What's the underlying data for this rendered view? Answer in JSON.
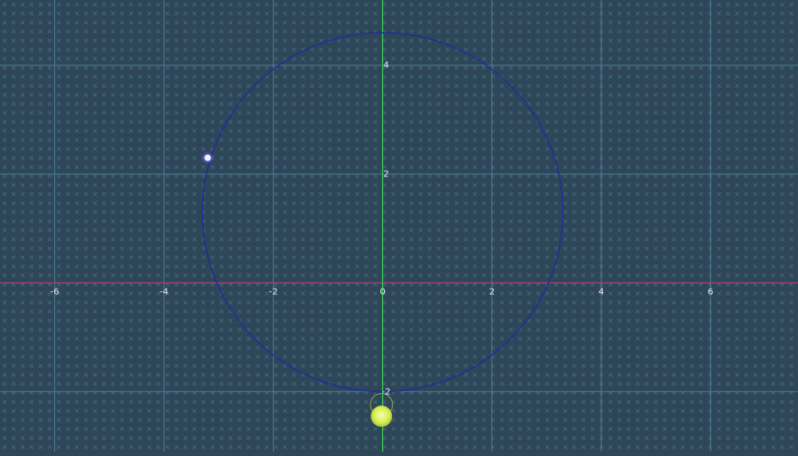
{
  "plot": {
    "x_axis_ticks": [
      "-6",
      "-4",
      "-2",
      "0",
      "2",
      "4",
      "6"
    ],
    "y_axis_ticks": [
      "4",
      "2",
      "-2"
    ],
    "x_range": [
      -7,
      7.6
    ],
    "y_range": [
      -3.1,
      5.2
    ],
    "grid": true,
    "minor_grid_marker": "x",
    "circle": {
      "center": [
        0,
        1.3
      ],
      "radius": 3.3,
      "color": "#1f2f9a"
    },
    "points": [
      {
        "name": "blue-point",
        "x": -3.2,
        "y": 2.3,
        "color": "#6e6cff"
      },
      {
        "name": "yellow-point",
        "x": -0.02,
        "y": -2.45,
        "color": "#d4ef52"
      }
    ],
    "colors": {
      "background": "#2e4657",
      "major_grid": "#4d7d96",
      "minor_marks": "#4f8aa3",
      "x_axis": "#b0406e",
      "y_axis": "#39cc52"
    }
  }
}
